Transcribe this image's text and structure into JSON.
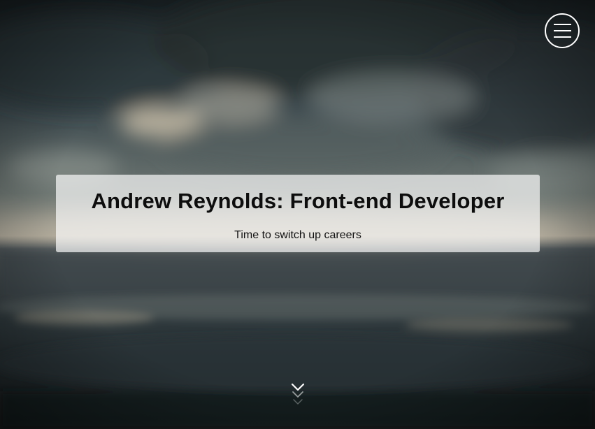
{
  "hero": {
    "title": "Andrew Reynolds: Front-end Developer",
    "subtitle": "Time to switch up careers"
  },
  "menu": {
    "icon": "hamburger-menu-icon",
    "color": "#ffffff"
  },
  "scroll": {
    "icon": "chevron-down-icon"
  },
  "colors": {
    "sky_dark": "#1f2a2e",
    "sky_light": "#d9d2c2",
    "banner_bg": "#ffffff",
    "title_text": "#0d0d0d"
  }
}
